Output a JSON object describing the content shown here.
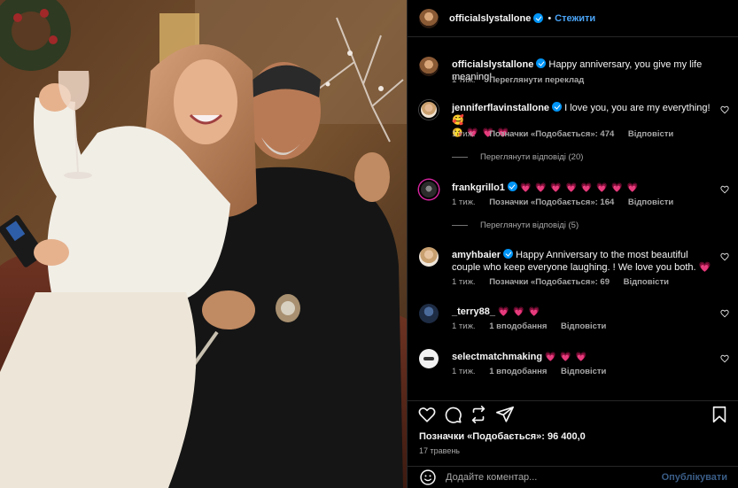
{
  "header": {
    "username": "officialslystallone",
    "separator": "•",
    "follow_label": "Стежити"
  },
  "caption": {
    "username": "officialslystallone",
    "text": "Happy anniversary, you give my life meaning!",
    "time": "1 тиж.",
    "translate_label": "Переглянути переклад"
  },
  "comments": [
    {
      "username": "jenniferflavinstallone",
      "text": "I love you, you are my everything!🥰",
      "text2": "😘 💗 💗 💗",
      "time": "1 тиж.",
      "likes": "Позначки «Подобається»: 474",
      "reply_label": "Відповісти",
      "view_replies": "Переглянути відповіді (20)"
    },
    {
      "username": "frankgrillo1",
      "text": "💗 💗 💗 💗 💗 💗 💗 💗",
      "time": "1 тиж.",
      "likes": "Позначки «Подобається»: 164",
      "reply_label": "Відповісти",
      "view_replies": "Переглянути відповіді (5)"
    },
    {
      "username": "amyhbaier",
      "text": "Happy Anniversary to the most beautiful couple who keep everyone laughing. ! We love you both. 💗",
      "time": "1 тиж.",
      "likes": "Позначки «Подобається»: 69",
      "reply_label": "Відповісти"
    },
    {
      "username": "_terry88_",
      "text": "💗 💗 💗",
      "time": "1 тиж.",
      "likes": "1 вподобання",
      "reply_label": "Відповісти"
    },
    {
      "username": "selectmatchmaking",
      "text": "💗 💗 💗",
      "time": "1 тиж.",
      "likes": "1 вподобання",
      "reply_label": "Відповісти"
    }
  ],
  "footer": {
    "likes": "Позначки «Подобається»: 96 400,0",
    "date": "17 травень",
    "comment_placeholder": "Додайте коментар...",
    "post_label": "Опублікувати"
  },
  "colors": {
    "background": "#000000",
    "link": "#4aa3f5",
    "heart": "#ff3b73",
    "verified": "#0095f6"
  },
  "icons": [
    "heart-icon",
    "comment-icon",
    "share-icon",
    "send-icon",
    "bookmark-icon",
    "emoji-icon",
    "verified-icon"
  ]
}
